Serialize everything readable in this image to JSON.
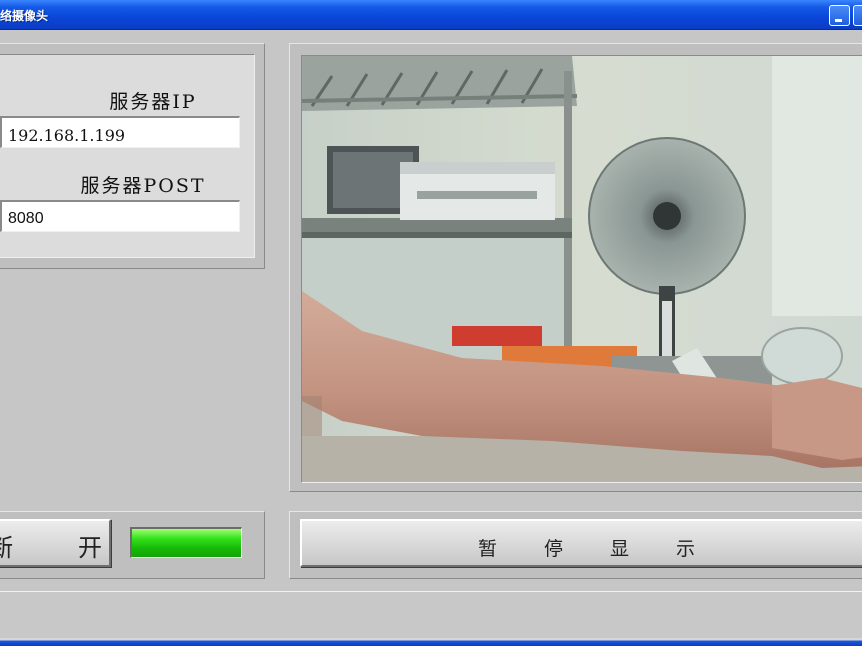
{
  "window": {
    "title": "络摄像头"
  },
  "settings": {
    "ip_label": "服务器IP",
    "ip_value": "192.168.1.199",
    "port_label": "服务器POST",
    "port_value": "8080"
  },
  "controls": {
    "disconnect_chars": [
      "断",
      "开"
    ],
    "status_color": "#33e01a"
  },
  "display": {
    "pause_chars": [
      "暂",
      "停",
      "显",
      "示"
    ]
  },
  "icons": {
    "minimize": "minimize-icon",
    "maximize": "maximize-icon",
    "status": "status-indicator"
  }
}
